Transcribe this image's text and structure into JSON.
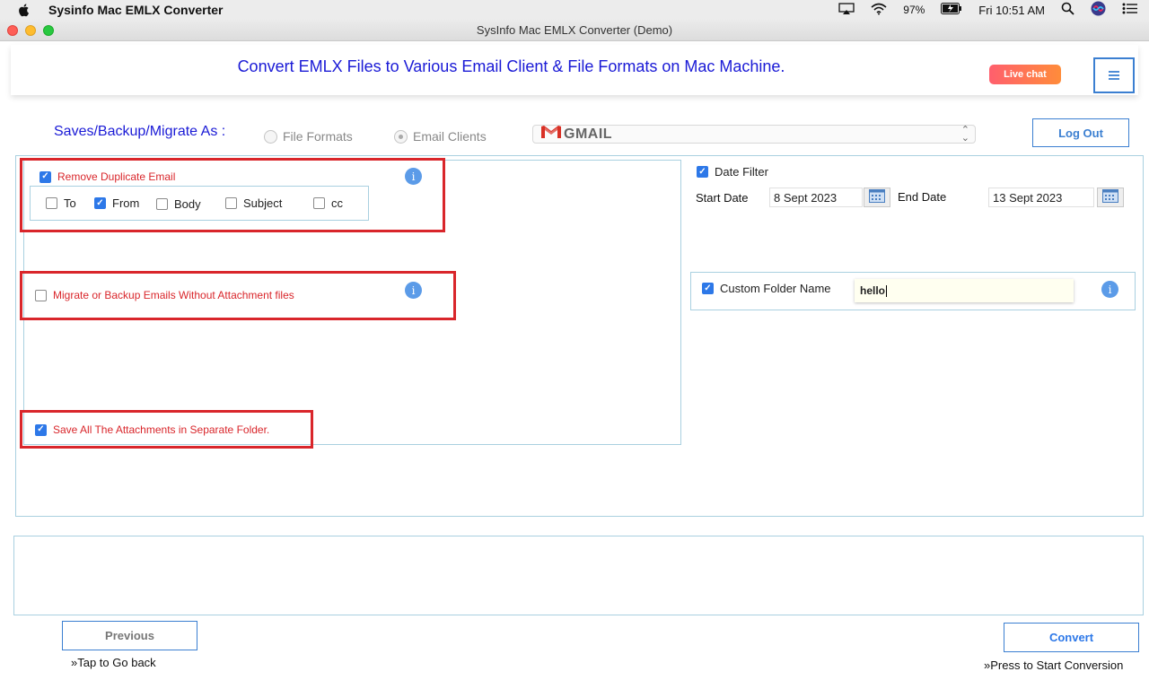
{
  "menubar": {
    "app_name": "Sysinfo Mac EMLX Converter",
    "battery": "97%",
    "clock": "Fri 10:51 AM"
  },
  "window": {
    "title": "SysInfo Mac EMLX Converter (Demo)"
  },
  "banner": {
    "title": "Convert EMLX Files to Various Email Client & File Formats on Mac Machine.",
    "live_chat": "Live chat"
  },
  "save_row": {
    "label": "Saves/Backup/Migrate As :",
    "radio_file_formats": "File Formats",
    "radio_email_clients": "Email Clients",
    "selected_radio": "Email Clients",
    "selected_client": "GMAIL",
    "logout": "Log Out"
  },
  "options": {
    "remove_duplicate": {
      "label": "Remove Duplicate Email",
      "checked": true
    },
    "dup_fields": [
      {
        "label": "To",
        "checked": false
      },
      {
        "label": "From",
        "checked": true
      },
      {
        "label": "Body",
        "checked": false
      },
      {
        "label": "Subject",
        "checked": false
      },
      {
        "label": "cc",
        "checked": false
      }
    ],
    "without_attachments": {
      "label": "Migrate or Backup Emails Without Attachment files",
      "checked": false
    },
    "save_attachments": {
      "label": "Save All The Attachments in Separate Folder.",
      "checked": true
    },
    "info_glyph": "i"
  },
  "date_filter": {
    "label": "Date Filter",
    "checked": true,
    "start_label": "Start Date",
    "start_value": "8 Sept 2023",
    "end_label": "End Date",
    "end_value": "13 Sept 2023"
  },
  "custom_folder": {
    "label": "Custom Folder Name",
    "checked": true,
    "value": "hello"
  },
  "footer": {
    "previous": "Previous",
    "previous_hint": "»Tap to Go back",
    "convert": "Convert",
    "convert_hint": "»Press to Start Conversion"
  },
  "colors": {
    "accent_blue": "#1a1ad6",
    "button_blue": "#3b7fd1",
    "highlight_red": "#d9262b",
    "panel_border": "#a9d0e0"
  }
}
